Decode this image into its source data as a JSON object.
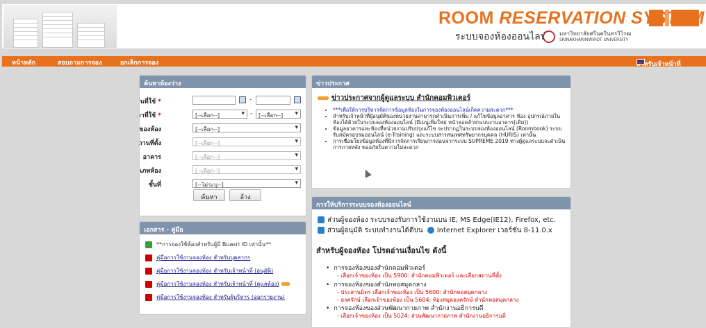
{
  "header": {
    "title_part1": "ROOM ",
    "title_part2": "RESERVATION SYSTEM",
    "subtitle": "ระบบจองห้องออนไลน์",
    "univ_th": "มหาวิทยาลัยศรีนครินทรวิโรฒ",
    "univ_en": "SRINAKHARINWIROT UNIVERSITY",
    "accent": "#e8711d"
  },
  "nav": {
    "home": "หน้าหลัก",
    "inquiry": "สอบถามการจอง",
    "cancel": "ยกเลิกการจอง",
    "staff": "สำหรับเจ้าหน้าที่"
  },
  "search": {
    "title": "ค้นหาห้องว่าง",
    "date_label": "วันที่ใช้",
    "time_label": "เวลาที่ใช้",
    "owner_label": "เจ้าของห้อง",
    "location_label": "สถานที่ตั้ง",
    "building_label": "อาคาร",
    "roomtype_label": "ประเภทห้อง",
    "floor_label": "ชั้นที่",
    "required_mark": "*",
    "date_sep": "-",
    "time_sep": "-",
    "select_placeholder": "[--เลือก--]",
    "floor_placeholder": "[--ไม่ระบุ--]",
    "search_button": "ค้นหา",
    "clear_button": "ล้าง"
  },
  "docs": {
    "title": "เอกสาร - คู่มือ",
    "items": [
      {
        "text": "**การจองใช้ห้องสำหรับผู้มี Buasri ID เท่านั้น**",
        "icon": "line-icon"
      },
      {
        "text": "คู่มือการใช้งานจองห้อง สำหรับบุคลากร",
        "icon": "pdf-icon"
      },
      {
        "text": "คู่มือการใช้งานจองห้อง สำหรับเจ้าหน้าที่ (อนุมัติ)",
        "icon": "pdf-icon"
      },
      {
        "text": "คู่มือการใช้งานจองห้อง สำหรับเจ้าหน้าที่ (ดูแลห้อง)",
        "icon": "pdf-icon"
      },
      {
        "text": "คู่มือการใช้งานจองห้อง สำหรับผู้บริหาร (ออกรายงาน)",
        "icon": "pdf-icon"
      }
    ]
  },
  "news": {
    "title": "ข่าวประกาศ",
    "headline": "ข่าวประกาศจากผู้ดูแลระบบ สำนักคอมพิวเตอร์",
    "items": [
      "***เพื่อให้การบริหารจัดการข้อมูลห้องในการจองห้องออนไลน์เกิดความสะดวก***",
      "สำหรับเจ้าหน้าที่ผู้อนุมัติของหน่วยงานสามารถดำเนินการเพิ่ม / แก้ไขข้อมูลอาคาร ห้อง อุปกรณ์ภายในห้องได้ด้วยในระบบจองห้องออนไลน์ (มีเมนูเพิ่มใหม่ หน้าจอคล้ายระบบงานอาคาร(เดิม))",
      "ข้อมูลอาคารและห้องที่หน่วยงานปรับปรุงแก้ไข จะปรากฏในระบบจองห้องออนไลน์ (Roombook) ระบบรับสมัครอบรมออนไลน์ (e-Training) และระบบสารสนเทศทรัพยากรบุคคล (HURIS) เท่านั้น",
      "การเชื่อมโยงข้อมูลห้องที่มีการจัดการเรียนการสอนจากระบบ SUPREME 2019 ทางผู้ดูแลระบบจะดำเนินการภายหลัง ขออภัยในความไม่สะดวก"
    ]
  },
  "service": {
    "title": "การให้บริการระบบจองห้องออนไลน์",
    "line1": "ส่วนผู้จองห้อง ระบบรองรับการใช้งานบน IE, MS Edge(IE12), Firefox, etc.",
    "line2a": "ส่วนผู้อนุมัติ ระบบทำงานได้ดีบน",
    "line2b": "Internet Explorer เวอร์ชัน 8-11.0.x",
    "heading": "สำหรับผู้จองห้อง โปรดอ่านเงื่อนไข ดังนี้",
    "b1": "การจองห้องของสำนักคอมพิวเตอร์",
    "b1r": "- เลือกเจ้าของห้อง เป็น 5900: สำนักคอมพิวเตอร์ และเลือกสถานที่ตั้ง",
    "b2": "การจองห้องของสำนักหอสมุดกลาง",
    "b2r1": "- ประสานมิตร เลือกเจ้าของห้อง เป็น 5600: สำนักหอสมุดกลาง",
    "b2r2": "- องครักษ์ เลือกเจ้าของห้อง เป็น 5604: ห้องสมุดองครักษ์ สำนักหอสมุดกลาง",
    "b3": "การจองห้องของส่วนพัฒนากายภาพ สำนักงานอธิการบดี",
    "b3r": "- เลือกเจ้าของห้อง เป็น 5024: ส่วนพัฒนากายภาพ สำนักงานอธิการบดี"
  }
}
